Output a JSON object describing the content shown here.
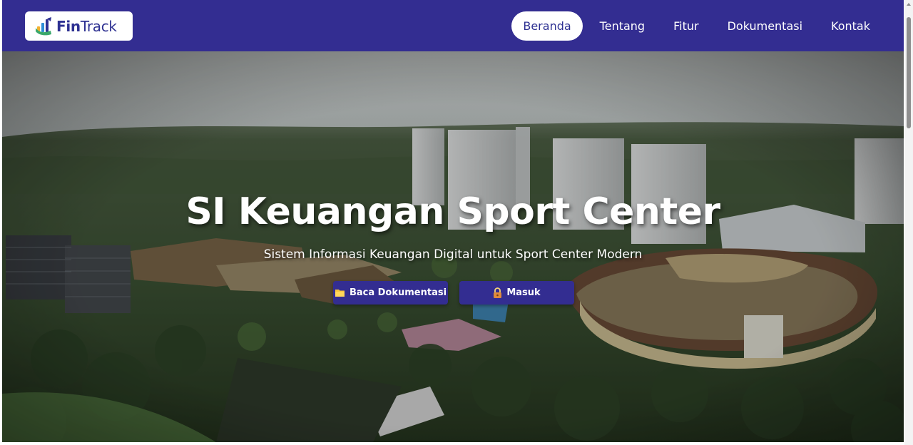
{
  "brand": {
    "name_bold": "Fin",
    "name_light": "Track",
    "colors": {
      "primary": "#332d91",
      "text_on_white": "#2e3192"
    }
  },
  "nav": {
    "items": [
      {
        "label": "Beranda",
        "active": true
      },
      {
        "label": "Tentang",
        "active": false
      },
      {
        "label": "Fitur",
        "active": false
      },
      {
        "label": "Dokumentasi",
        "active": false
      },
      {
        "label": "Kontak",
        "active": false
      }
    ]
  },
  "hero": {
    "title": "SI Keuangan Sport Center",
    "subtitle": "Sistem Informasi Keuangan Digital untuk Sport Center Modern",
    "buttons": {
      "docs": {
        "label": "Baca Dokumentasi",
        "icon": "folder-icon"
      },
      "login": {
        "label": "Masuk",
        "icon": "lock-icon"
      }
    },
    "background": "sport-center-aerial-rendering"
  }
}
